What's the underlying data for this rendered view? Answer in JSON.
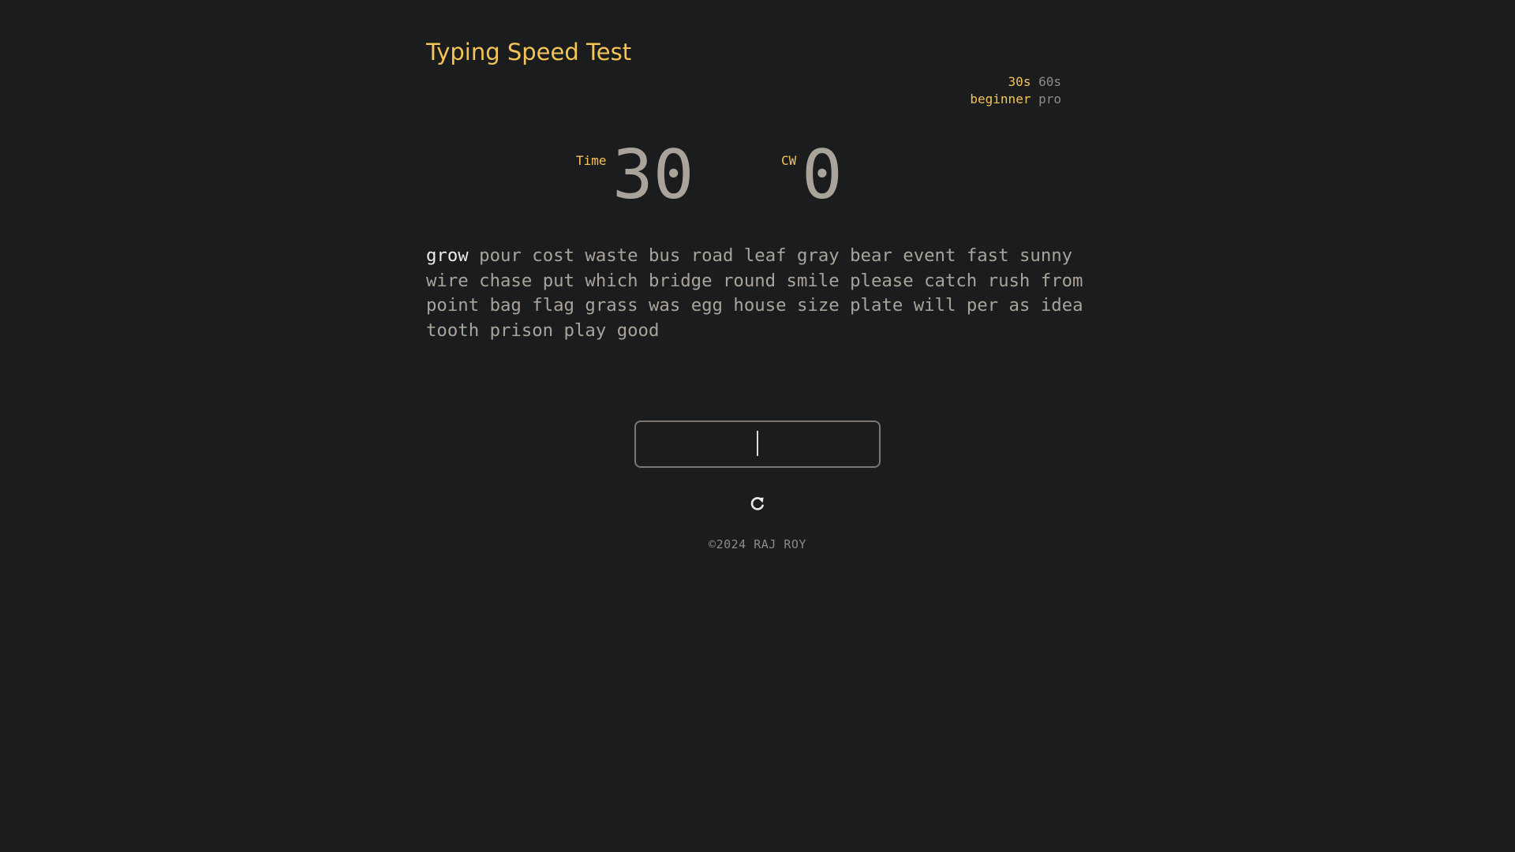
{
  "app": {
    "title": "Typing Speed Test"
  },
  "settings": {
    "durations": [
      {
        "label": "30s",
        "active": true
      },
      {
        "label": "60s",
        "active": false
      }
    ],
    "levels": [
      {
        "label": "beginner",
        "active": true
      },
      {
        "label": "pro",
        "active": false
      }
    ]
  },
  "stats": {
    "time_label": "Time",
    "time_value": "30",
    "cw_label": "CW",
    "cw_value": "0"
  },
  "words": {
    "current": "grow",
    "list": [
      "grow",
      "pour",
      "cost",
      "waste",
      "bus",
      "road",
      "leaf",
      "gray",
      "bear",
      "event",
      "fast",
      "sunny",
      "wire",
      "chase",
      "put",
      "which",
      "bridge",
      "round",
      "smile",
      "please",
      "catch",
      "rush",
      "from",
      "point",
      "bag",
      "flag",
      "grass",
      "was",
      "egg",
      "house",
      "size",
      "plate",
      "will",
      "per",
      "as",
      "idea",
      "tooth",
      "prison",
      "play",
      "good"
    ]
  },
  "input": {
    "value": "",
    "placeholder": ""
  },
  "controls": {
    "refresh_icon": "refresh-icon"
  },
  "footer": {
    "text": "©2024 RAJ ROY"
  },
  "colors": {
    "background": "#1b1c1e",
    "accent": "#f4c455",
    "text": "#a9a39a",
    "text_muted": "#8f8a84",
    "current_word": "#ececec",
    "input_border": "#7c7770"
  }
}
